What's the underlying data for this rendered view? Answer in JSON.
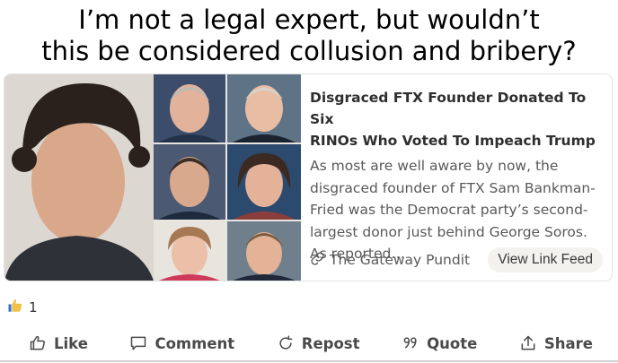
{
  "caption": {
    "line1": "I’m not a legal expert, but wouldn’t",
    "line2": "this be considered collusion and bribery?"
  },
  "link_card": {
    "title_line1": "Disgraced FTX Founder Donated To Six",
    "title_line2": "RINOs Who Voted To Impeach Trump",
    "desc_lines": [
      "As most are well aware by now, the",
      "disgraced founder of FTX Sam Bankman-",
      "Fried was the Democrat party’s second-",
      "largest donor just behind George Soros.",
      "As reported…"
    ],
    "source": "The Gateway Pundit",
    "view_feed_label": "View Link Feed",
    "thumbnail_icon": "portrait-collage"
  },
  "reactions": {
    "count": "1",
    "icon": "thumbs-up-icon"
  },
  "actions": {
    "like": "Like",
    "comment": "Comment",
    "repost": "Repost",
    "quote": "Quote",
    "share": "Share"
  },
  "colors": {
    "like_blue": "#2f74c4",
    "like_yellow": "#f0c14b",
    "muted_text": "#595959"
  }
}
